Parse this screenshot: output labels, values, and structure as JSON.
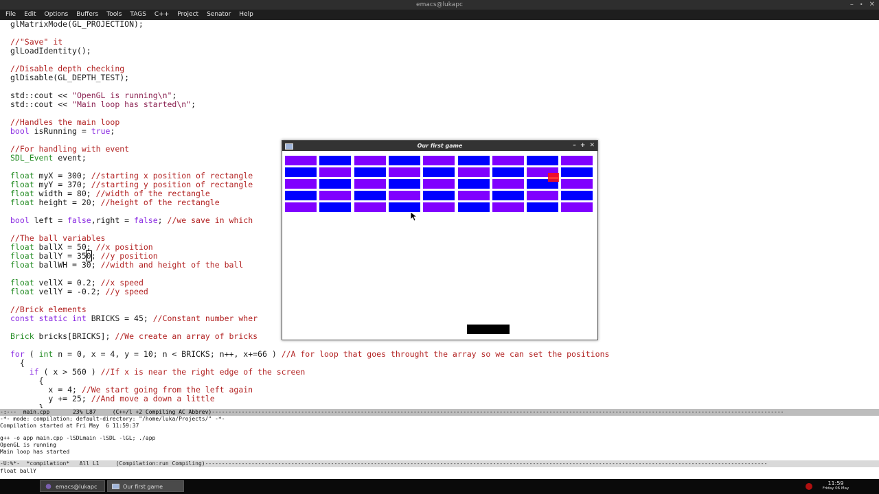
{
  "window": {
    "title": "emacs@lukapc",
    "controls": [
      "–",
      "⬝",
      "✕"
    ]
  },
  "menubar": {
    "items": [
      "File",
      "Edit",
      "Options",
      "Buffers",
      "Tools",
      "TAGS",
      "C++",
      "Project",
      "Senator",
      "Help"
    ]
  },
  "code": {
    "l01": "glMatrixMode(GL_PROJECTION);",
    "l03": "//\"Save\" it",
    "l04": "glLoadIdentity();",
    "l06": "//Disable depth checking",
    "l07": "glDisable(GL_DEPTH_TEST);",
    "l09a": "std::cout << ",
    "l09b": "\"OpenGL is running\\n\"",
    "l09c": ";",
    "l10a": "std::cout << ",
    "l10b": "\"Main loop has started\\n\"",
    "l10c": ";",
    "l12": "//Handles the main loop",
    "l13a": "bool",
    "l13b": " isRunning = ",
    "l13c": "true",
    "l13d": ";",
    "l15": "//For handling with event",
    "l16a": "SDL_Event",
    "l16b": " event;",
    "l18a": "float",
    "l18b": " myX = 300; ",
    "l18c": "//starting x position of rectangle",
    "l19a": "float",
    "l19b": " myY = 370; ",
    "l19c": "//starting y position of rectangle",
    "l20a": "float",
    "l20b": " width = 80; ",
    "l20c": "//width of the rectangle",
    "l21a": "float",
    "l21b": " height = 20; ",
    "l21c": "//height of the rectangle",
    "l23a": "bool",
    "l23b": " left = ",
    "l23c": "false",
    "l23d": ",right = ",
    "l23e": "false",
    "l23f": "; ",
    "l23g": "//we save in which",
    "l25": "//The ball variables",
    "l26a": "float",
    "l26b": " ballX = 50; ",
    "l26c": "//x position",
    "l27a": "float",
    "l27b": " ballY = 35",
    "l27cur": "0",
    "l27d": "; ",
    "l27e": "//y position",
    "l28a": "float",
    "l28b": " ballWH = 30; ",
    "l28c": "//width and height of the ball",
    "l30a": "float",
    "l30b": " vellX = 0.2; ",
    "l30c": "//x speed",
    "l31a": "float",
    "l31b": " vellY = -0.2; ",
    "l31c": "//y speed",
    "l33": "//Brick elements",
    "l34a": "const static int",
    "l34b": " BRICKS = 45; ",
    "l34c": "//Constant number wher",
    "l36a": "Brick",
    "l36b": " bricks[BRICKS]; ",
    "l36c": "//We create an array of bricks",
    "l38a": "for",
    "l38b": " ( ",
    "l38c": "int",
    "l38d": " n = 0, x = 4, y = 10; n < BRICKS; n++, x+=66 ) ",
    "l38e": "//A for loop that goes throught the array so we can set the positions",
    "l39": "  {",
    "l40a": "    if",
    "l40b": " ( x > 560 ) ",
    "l40c": "//If x is near the right edge of the screen",
    "l41": "      {",
    "l42a": "        x = 4; ",
    "l42b": "//We start going from the left again",
    "l43a": "        y += 25; ",
    "l43b": "//And move a down a little",
    "l44": "      }"
  },
  "modeline_main": "-:---  main.cpp       23% L87     (C++/l +2 Compiling AC Abbrev)-----------------------------------------------------------------------------------------------------------------------------------------------------------------------------",
  "compilation": {
    "line1": "-*- mode: compilation; default-directory: \"/home/luka/Projects/\" -*-",
    "line2": "Compilation started at Fri May  6 11:59:37",
    "line4": "g++ -o app main.cpp -lSDLmain -lSDL -lGL; ./app",
    "line5": "OpenGL is running",
    "line6": "Main loop has started"
  },
  "modeline_comp": "-U:%*-  *compilation*   All L1     (Compilation:run Compiling)--------------------------------------------------------------------------------------------------------------------------------------------------------------------------",
  "echo_area": "float ballY",
  "game": {
    "title": "Our first game",
    "brick_colors": {
      "purple": "#8000ff",
      "blue": "#0000ff"
    },
    "brick_rows": [
      [
        "purple",
        "blue",
        "purple",
        "blue",
        "purple",
        "blue",
        "purple",
        "blue",
        "purple"
      ],
      [
        "blue",
        "purple",
        "blue",
        "purple",
        "blue",
        "purple",
        "blue",
        "purple",
        "blue"
      ],
      [
        "purple",
        "blue",
        "purple",
        "blue",
        "purple",
        "blue",
        "purple",
        "blue",
        "purple"
      ],
      [
        "blue",
        "purple",
        "blue",
        "purple",
        "blue",
        "purple",
        "blue",
        "purple",
        "blue"
      ],
      [
        "purple",
        "blue",
        "purple",
        "blue",
        "purple",
        "blue",
        "purple",
        "blue",
        "purple"
      ]
    ],
    "ball_color": "#ff1111",
    "paddle_color": "#000000"
  },
  "taskbar": {
    "tasks": [
      {
        "label": "emacs@lukapc",
        "icon": "emacs-icon"
      },
      {
        "label": "Our first game",
        "icon": "window-icon"
      }
    ],
    "clock_time": "11:59",
    "clock_date": "Friday 06 May"
  }
}
